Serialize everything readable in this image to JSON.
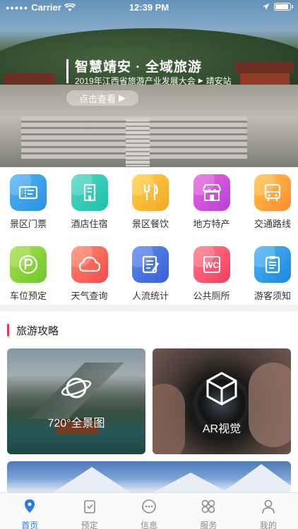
{
  "status_bar": {
    "carrier": "Carrier",
    "time": "12:39 PM"
  },
  "hero": {
    "title": "智慧靖安 · 全域旅游",
    "subtitle": "2019年江西省旅游产业发展大会",
    "station": "靖安站",
    "button": "点击查看"
  },
  "grid": [
    {
      "label": "景区门票",
      "icon": "ticket-icon",
      "color_from": "#4fb6f5",
      "color_to": "#2a8fe0"
    },
    {
      "label": "酒店住宿",
      "icon": "hotel-icon",
      "color_from": "#4fd9c6",
      "color_to": "#1fbfa8"
    },
    {
      "label": "景区餐饮",
      "icon": "cutlery-icon",
      "color_from": "#ffd24a",
      "color_to": "#f5a623"
    },
    {
      "label": "地方特产",
      "icon": "shop-icon",
      "color_from": "#e866d8",
      "color_to": "#b93fdc"
    },
    {
      "label": "交通路线",
      "icon": "bus-icon",
      "color_from": "#ffc447",
      "color_to": "#ff8a34"
    },
    {
      "label": "车位预定",
      "icon": "parking-icon",
      "color_from": "#a8e04a",
      "color_to": "#6cc72e"
    },
    {
      "label": "天气查询",
      "icon": "cloud-icon",
      "color_from": "#ff8a6a",
      "color_to": "#f14b4b"
    },
    {
      "label": "人流统计",
      "icon": "statistics-icon",
      "color_from": "#5a8cf0",
      "color_to": "#3a5fd8"
    },
    {
      "label": "公共厕所",
      "icon": "toilet-icon",
      "color_from": "#ff7a8a",
      "color_to": "#f23e5e"
    },
    {
      "label": "游客须知",
      "icon": "notice-icon",
      "color_from": "#4ab4f2",
      "color_to": "#1f86e0"
    }
  ],
  "section": {
    "title": "旅游攻略"
  },
  "cards": [
    {
      "caption": "720°全景图",
      "icon": "planet-icon"
    },
    {
      "caption": "AR视觉",
      "icon": "cube-icon"
    }
  ],
  "tabbar": [
    {
      "label": "首页",
      "icon": "location-pin-icon",
      "active": true
    },
    {
      "label": "预定",
      "icon": "booking-icon",
      "active": false
    },
    {
      "label": "信息",
      "icon": "chat-icon",
      "active": false
    },
    {
      "label": "服务",
      "icon": "services-icon",
      "active": false
    },
    {
      "label": "我的",
      "icon": "user-icon",
      "active": false
    }
  ],
  "colors": {
    "accent": "#2a7ae2",
    "section_bar": "#e8385a"
  }
}
